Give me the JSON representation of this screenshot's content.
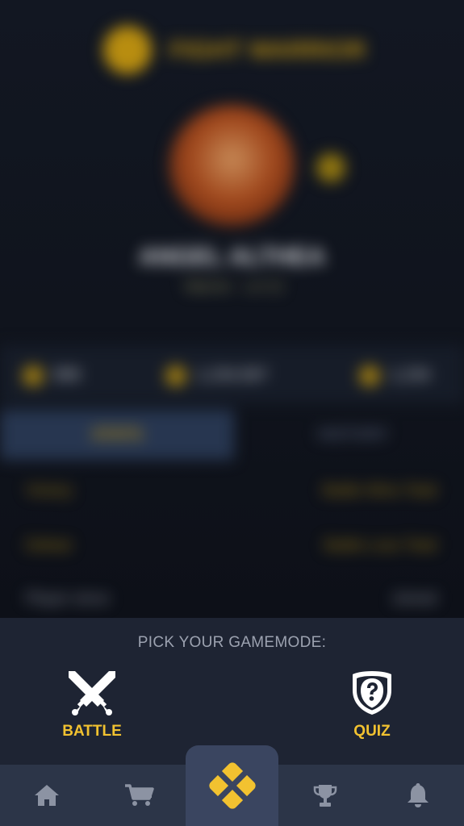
{
  "background": {
    "coin_label": "",
    "title": "FIGHT WARRIOR",
    "name": "ANGEL ALTHEA",
    "subtitle": "Warrior · Lvl 12",
    "stats": [
      {
        "value": "999"
      },
      {
        "value": "1,234,567"
      },
      {
        "value": "1,234"
      }
    ],
    "tabs": [
      "STATS",
      "HISTORY"
    ],
    "rows": [
      {
        "label": "Victory",
        "value": "Battle Wins Total"
      },
      {
        "label": "Defeat",
        "value": "Battle Loss Total"
      },
      {
        "label": "Player since",
        "value": "Joined"
      }
    ]
  },
  "picker": {
    "title": "PICK YOUR GAMEMODE:",
    "modes": [
      {
        "label": "BATTLE",
        "icon": "crossed-swords-icon"
      },
      {
        "label": "QUIZ",
        "icon": "question-shield-icon"
      }
    ]
  },
  "nav": {
    "items": [
      {
        "name": "home",
        "icon": "home-icon"
      },
      {
        "name": "shop",
        "icon": "cart-icon"
      },
      {
        "name": "play",
        "icon": "play-x-icon"
      },
      {
        "name": "trophies",
        "icon": "trophy-icon"
      },
      {
        "name": "notifications",
        "icon": "bell-icon"
      }
    ]
  },
  "colors": {
    "accent": "#f2c230",
    "sheet": "#1e2433",
    "nav": "#2c3548",
    "nav_center": "#3a4560",
    "nav_icon": "#8c93a3"
  }
}
